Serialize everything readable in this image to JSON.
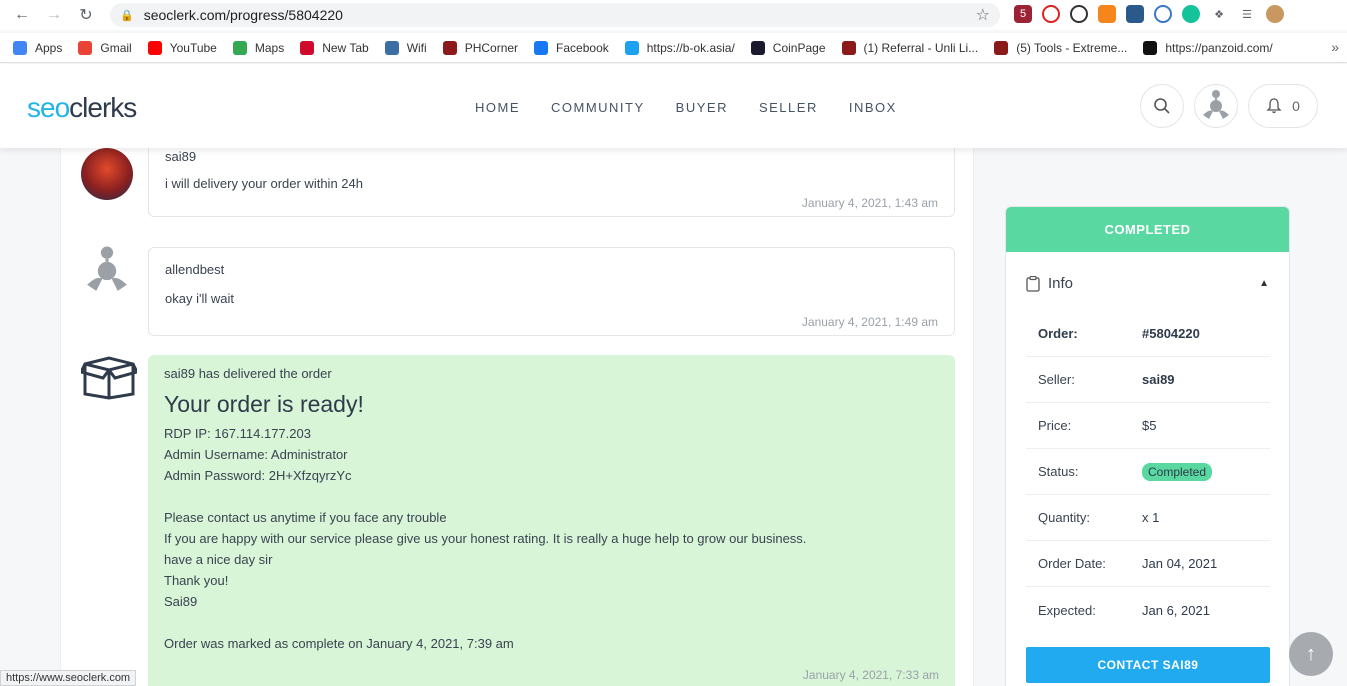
{
  "browser": {
    "url": "seoclerk.com/progress/5804220",
    "status_url": "https://www.seoclerk.com",
    "bookmarks": [
      {
        "label": "Apps",
        "icon": "apps-grid-icon"
      },
      {
        "label": "Gmail",
        "icon": "gmail-icon"
      },
      {
        "label": "YouTube",
        "icon": "youtube-icon"
      },
      {
        "label": "Maps",
        "icon": "maps-icon"
      },
      {
        "label": "New Tab",
        "icon": "huawei-icon"
      },
      {
        "label": "Wifi",
        "icon": "globe-icon"
      },
      {
        "label": "PHCorner",
        "icon": "shield-icon"
      },
      {
        "label": "Facebook",
        "icon": "facebook-icon"
      },
      {
        "label": "https://b-ok.asia/",
        "icon": "book-icon"
      },
      {
        "label": "CoinPage",
        "icon": "coin-icon"
      },
      {
        "label": "(1) Referral - Unli Li...",
        "icon": "shield-icon"
      },
      {
        "label": "(5) Tools - Extreme...",
        "icon": "shield-icon"
      },
      {
        "label": "https://panzoid.com/",
        "icon": "panzoid-icon"
      }
    ],
    "more": "»"
  },
  "header": {
    "logo_seo": "seo",
    "logo_clerks": "clerks",
    "nav": [
      "HOME",
      "COMMUNITY",
      "BUYER",
      "SELLER",
      "INBOX"
    ],
    "notifications": "0"
  },
  "messages": [
    {
      "user": "sai89",
      "text": "i will delivery your order within 24h",
      "time": "January 4, 2021, 1:43 am"
    },
    {
      "user": "allendbest",
      "text": "okay i'll wait",
      "time": "January 4, 2021, 1:49 am"
    }
  ],
  "delivery": {
    "header": "sai89 has delivered the order",
    "title": "Your order is ready!",
    "lines": [
      "RDP IP: 167.114.177.203",
      "Admin Username: Administrator",
      "Admin Password: 2H+XfzqyrzYc",
      "",
      "Please contact us anytime if you face any trouble",
      "If you are happy with our service please give us your honest rating. It is really a huge help to grow our business.",
      "have a nice day sir",
      "Thank you!",
      "Sai89",
      "",
      "Order was marked as complete on January 4, 2021, 7:39 am"
    ],
    "time": "January 4, 2021, 7:33 am"
  },
  "sidebar": {
    "status_banner": "COMPLETED",
    "info_title": "Info",
    "rows": [
      {
        "k": "Order:",
        "v": "#5804220"
      },
      {
        "k": "Seller:",
        "v": "sai89"
      },
      {
        "k": "Price:",
        "v": "$5"
      },
      {
        "k": "Status:",
        "v": "Completed"
      },
      {
        "k": "Quantity:",
        "v": "x 1"
      },
      {
        "k": "Order Date:",
        "v": "Jan 04, 2021"
      },
      {
        "k": "Expected:",
        "v": "Jan 6, 2021"
      }
    ],
    "contact_label": "CONTACT SAI89"
  },
  "colors": {
    "accent": "#22aaf0",
    "success": "#59d8a1",
    "delivery_bg": "#d8f5d8"
  }
}
